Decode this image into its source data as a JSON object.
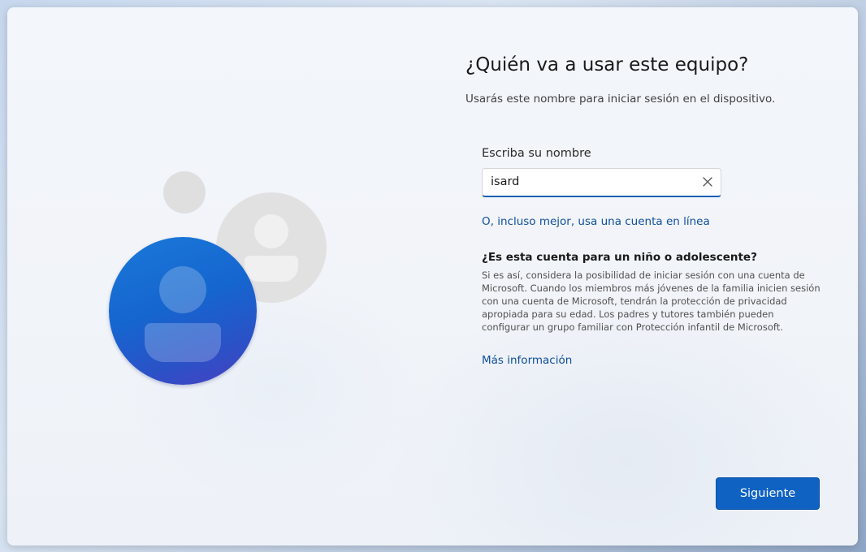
{
  "page": {
    "title": "¿Quién va a usar este equipo?",
    "subtitle": "Usarás este nombre para iniciar sesión en el dispositivo."
  },
  "name_field": {
    "label": "Escriba su nombre",
    "value": "isard",
    "clear_icon": "close-icon"
  },
  "online_account_link": "O, incluso mejor, usa una cuenta en línea",
  "child_section": {
    "title": "¿Es esta cuenta para un niño o adolescente?",
    "body": "Si es así, considera la posibilidad de iniciar sesión con una cuenta de Microsoft. Cuando los miembros más jóvenes de la familia inicien sesión con una cuenta de Microsoft, tendrán la protección de privacidad apropiada para su edad. Los padres y tutores también pueden configurar un grupo familiar con Protección infantil de Microsoft.",
    "more_info_link": "Más información"
  },
  "next_button": "Siguiente",
  "colors": {
    "accent": "#0f62c2",
    "link": "#0f4f9a",
    "avatar_blue": "#1566cf",
    "avatar_grey": "#e2e1e2"
  },
  "illustration": {
    "icons": [
      "user-avatar-icon",
      "secondary-user-icon",
      "small-dot-icon"
    ]
  }
}
